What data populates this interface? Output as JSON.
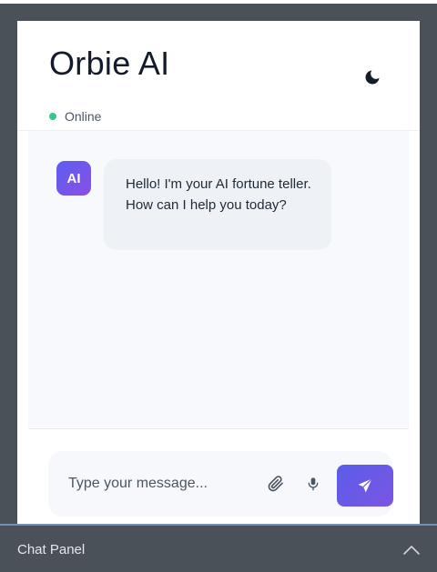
{
  "header": {
    "title": "Orbie AI",
    "status_text": "Online",
    "status_color": "#34c88a",
    "theme_toggle_icon": "moon-icon"
  },
  "messages": [
    {
      "sender_avatar": "AI",
      "text": "Hello! I'm your AI fortune teller. How can I help you today?"
    }
  ],
  "composer": {
    "placeholder": "Type your message...",
    "value": "",
    "attach_icon": "paperclip-icon",
    "mic_icon": "microphone-icon",
    "send_icon": "paper-plane-icon",
    "accent_color": "#6c5ce7"
  },
  "panel": {
    "label": "Chat Panel",
    "toggle_icon": "chevron-up-icon"
  }
}
